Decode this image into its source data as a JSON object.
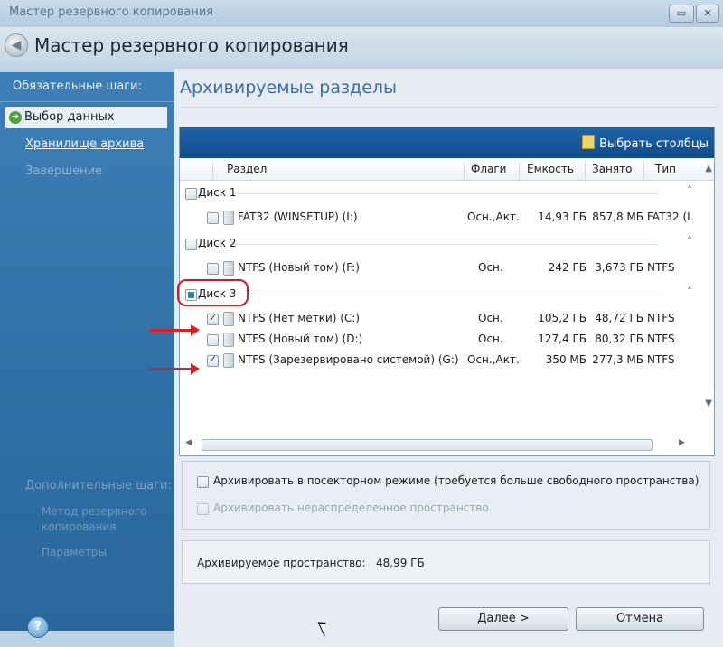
{
  "window": {
    "title": "Мастер резервного копирования",
    "header_title": "Мастер резервного копирования",
    "controls": [
      "minimize-icon",
      "maximize-icon",
      "close-icon"
    ]
  },
  "sidebar": {
    "heading": "Обязательные шаги:",
    "steps": [
      {
        "label": "Выбор данных",
        "state": "current"
      },
      {
        "label": "Хранилище архива",
        "state": "link"
      },
      {
        "label": "Завершение",
        "state": "disabled"
      }
    ],
    "extra_heading": "Дополнительные шаги:",
    "extra_steps": [
      {
        "label": "Метод резервного копирования"
      },
      {
        "label": "Параметры"
      }
    ]
  },
  "main": {
    "title": "Архивируемые разделы",
    "toolbar": {
      "select_columns": "Выбрать столбцы"
    },
    "columns": {
      "partition": "Раздел",
      "flags": "Флаги",
      "capacity": "Емкость",
      "used": "Занято",
      "type": "Тип"
    },
    "disks": [
      {
        "label": "Диск 1",
        "checked": false,
        "partitions": [
          {
            "name": "FAT32 (WINSETUP) (I:)",
            "flags": "Осн.,Акт.",
            "capacity": "14,93 ГБ",
            "used": "857,8 МБ",
            "type": "FAT32 (L",
            "checked": false
          }
        ]
      },
      {
        "label": "Диск 2",
        "checked": false,
        "partitions": [
          {
            "name": "NTFS (Новый том) (F:)",
            "flags": "Осн.",
            "capacity": "242 ГБ",
            "used": "3,673 ГБ",
            "type": "NTFS",
            "checked": false
          }
        ]
      },
      {
        "label": "Диск 3",
        "checked": "partial",
        "partitions": [
          {
            "name": "NTFS (Нет метки) (C:)",
            "flags": "Осн.",
            "capacity": "105,2 ГБ",
            "used": "48,72 ГБ",
            "type": "NTFS",
            "checked": true
          },
          {
            "name": "NTFS (Новый том) (D:)",
            "flags": "Осн.",
            "capacity": "127,4 ГБ",
            "used": "80,32 ГБ",
            "type": "NTFS",
            "checked": false
          },
          {
            "name": "NTFS (Зарезервировано системой) (G:)",
            "flags": "Осн.,Акт.",
            "capacity": "350 МБ",
            "used": "277,3 МБ",
            "type": "NTFS",
            "checked": true
          }
        ]
      }
    ],
    "options": {
      "sector_by_sector": "Архивировать в посекторном режиме (требуется больше свободного пространства)",
      "unallocated": "Архивировать нераспределенное пространство"
    },
    "info": {
      "label": "Архивируемое пространство:",
      "value": "48,99 ГБ"
    }
  },
  "buttons": {
    "next": "Далее >",
    "cancel": "Отмена"
  },
  "colors": {
    "sidebar_blue": "#2f6fa6",
    "toolbar_blue": "#1e63a8",
    "title_blue": "#3a6fa8",
    "annotation_red": "#d01f22"
  }
}
